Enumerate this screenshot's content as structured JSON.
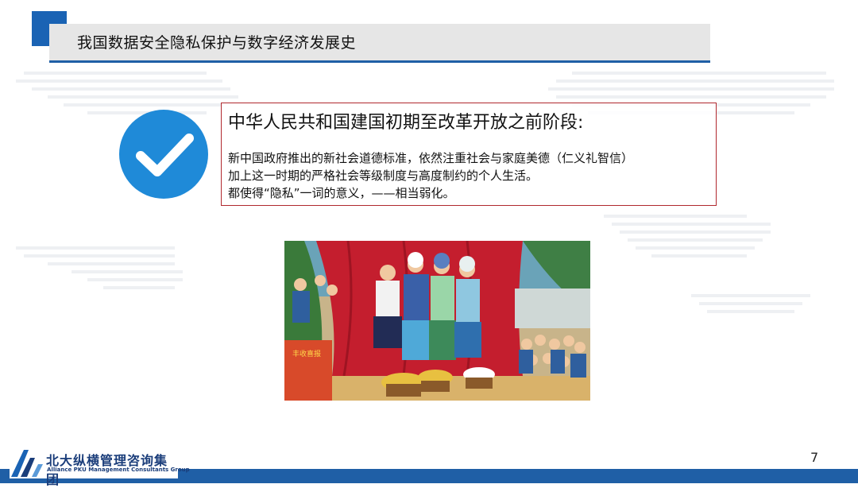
{
  "header": {
    "title": "我国数据安全隐私保护与数字经济发展史"
  },
  "content": {
    "heading": "中华人民共和国建国初期至改革开放之前阶段:",
    "lines": [
      "新中国政府推出的新社会道德标准，依然注重社会与家庭美德（仁义礼智信）",
      "加上这一时期的严格社会等级制度与高度制约的个人生活。",
      "都使得“隐私”一词的意义，——相当弱化。"
    ],
    "icon": "check-circle-icon"
  },
  "poster": {
    "banner_text": "丰收喜报"
  },
  "footer": {
    "page_number": "7",
    "logo_cn": "北大纵横管理咨询集团",
    "logo_en": "Alliance PKU Management Consultants Group"
  },
  "colors": {
    "accent": "#1a63b4",
    "check": "#1f8ad8",
    "border": "#b0282e"
  }
}
